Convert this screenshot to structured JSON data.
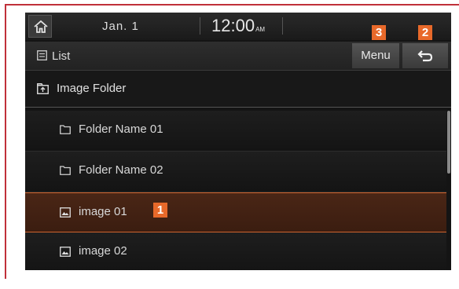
{
  "status_bar": {
    "date": "Jan.  1",
    "time": "12:00",
    "ampm": "AM"
  },
  "title_bar": {
    "title": "List",
    "menu_label": "Menu"
  },
  "folder": {
    "label": "Image Folder"
  },
  "items": [
    {
      "label": "Folder Name 01",
      "icon": "folder-icon"
    },
    {
      "label": "Folder Name 02",
      "icon": "folder-icon"
    },
    {
      "label": "image 01",
      "icon": "image-icon"
    },
    {
      "label": "image 02",
      "icon": "image-icon"
    }
  ],
  "callouts": {
    "c1": "1",
    "c2": "2",
    "c3": "3"
  },
  "colors": {
    "accent": "#e8692a",
    "frame": "#c0303a",
    "selected_bg": "#4a2616"
  }
}
